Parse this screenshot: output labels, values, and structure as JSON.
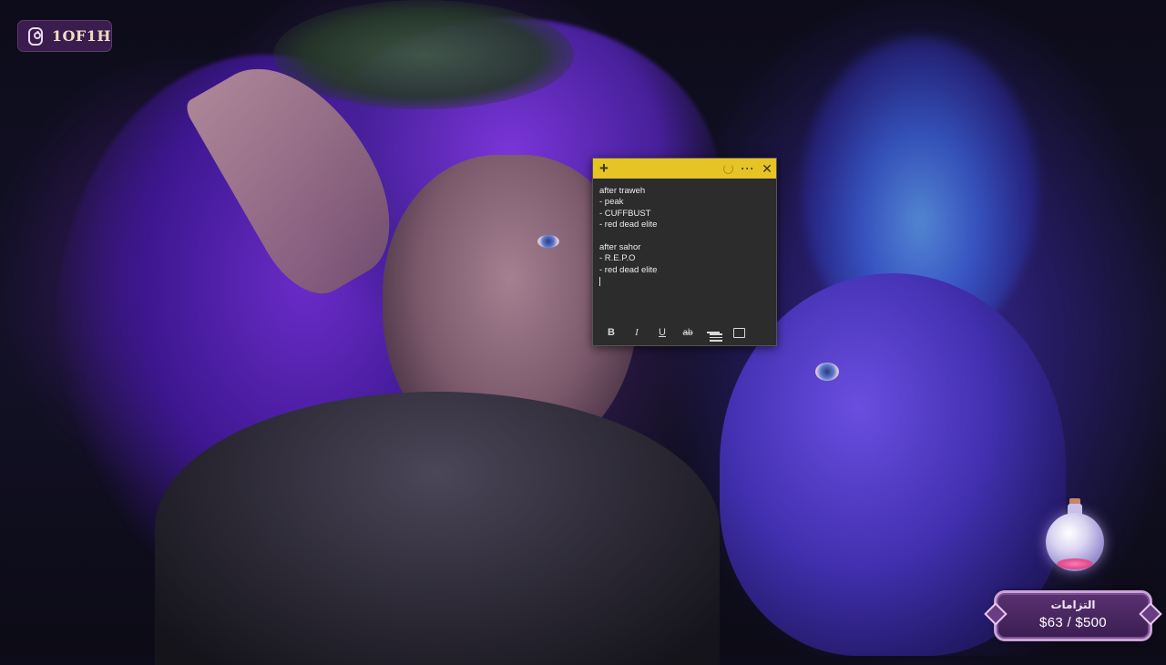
{
  "social": {
    "platform_icon": "instagram-icon",
    "handle": "1OF1H"
  },
  "sticky_note": {
    "toolbar_top": {
      "new_note_icon": "+",
      "more_icon": "···",
      "close_icon": "✕"
    },
    "lines": [
      "after traweh",
      "- peak",
      "- CUFFBUST",
      "- red dead elite",
      "",
      "after sahor",
      "- R.E.P.O",
      "- red dead elite"
    ],
    "format_toolbar": {
      "bold": "B",
      "italic": "I",
      "underline": "U",
      "strikethrough": "ab"
    },
    "colors": {
      "header": "#e6c425",
      "body": "#2c2c2c"
    }
  },
  "pledge_widget": {
    "title": "التزامات",
    "amount": "$63 / $500",
    "progress": 0.126
  }
}
